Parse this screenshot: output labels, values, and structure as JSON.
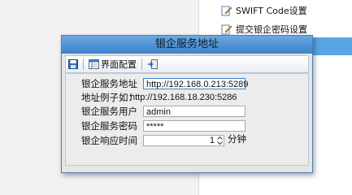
{
  "background": {
    "menu_items": [
      {
        "label": "SWIFT Code设置",
        "icon": "edit-icon"
      },
      {
        "label": "提交银企密码设置",
        "icon": "edit-icon"
      }
    ]
  },
  "dialog": {
    "title": "银企服务地址",
    "toolbar": {
      "save_icon": "save-icon",
      "layout_label": "界面配置",
      "layout_icon": "layout-icon",
      "exit_icon": "exit-icon"
    },
    "fields": {
      "server_address_label": "银企服务地址",
      "server_address_value": "http://192.168.0.213:5289",
      "example_label": "地址例子如：",
      "example_value": "http://192.168.18.230:5286",
      "user_label": "银企服务用户",
      "user_value": "admin",
      "password_label": "银企服务密码",
      "password_value": "*****",
      "timeout_label": "银企响应时间",
      "timeout_value": "1",
      "timeout_unit": "分钟"
    }
  }
}
